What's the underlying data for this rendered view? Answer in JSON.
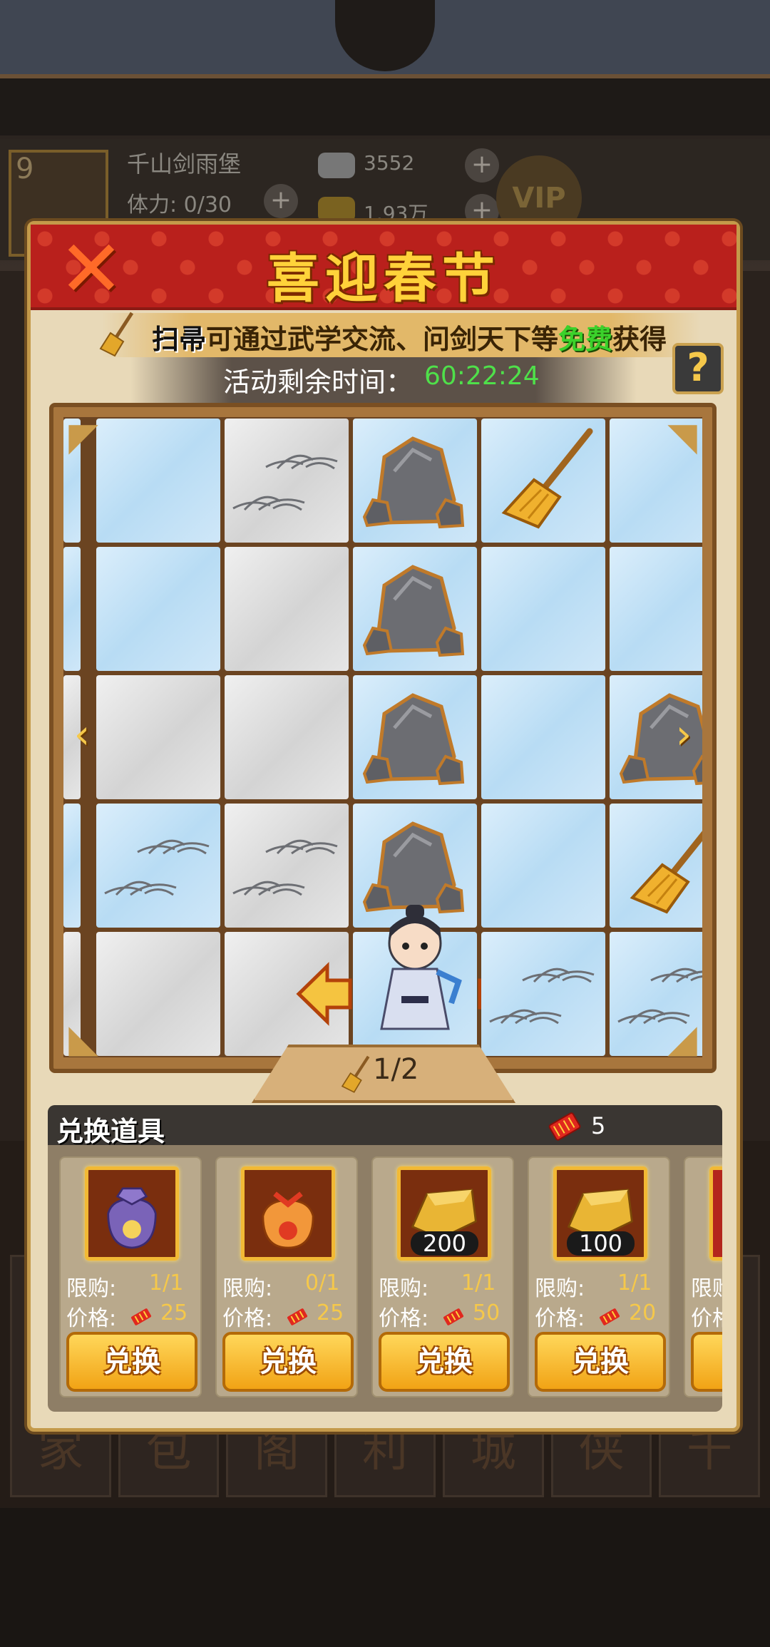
{
  "background": {
    "level": "9",
    "player_name": "千山剑雨堡",
    "stamina": "体力: 0/30",
    "silver": "3552",
    "gold": "1.93万",
    "vip_label": "VIP",
    "bottom_tabs": [
      "家",
      "包",
      "阁",
      "利",
      "城",
      "侠",
      "千"
    ]
  },
  "event": {
    "title": "喜迎春节",
    "close_symbol": "✕",
    "hint": {
      "keyword": "扫帚",
      "text1": "可通过武学交流、问剑天下等",
      "highlight": "免费",
      "text2": "获得"
    },
    "timer_label": "活动剩余时间：",
    "timer_value": "60:22:24",
    "help_symbol": "?",
    "page_indicator": "1/2",
    "board": {
      "rows": [
        [
          "snow",
          "gray-grass",
          "snow-rock",
          "snow-broom",
          "snow"
        ],
        [
          "snow",
          "gray",
          "snow-rock",
          "snow",
          "snow"
        ],
        [
          "gray",
          "gray",
          "snow-rock",
          "snow",
          "snow-rock"
        ],
        [
          "snow-grass",
          "gray-grass",
          "snow-rock",
          "snow",
          "snow-broom"
        ],
        [
          "gray",
          "gray",
          "hero",
          "snow-grass",
          "snow-grass"
        ]
      ]
    }
  },
  "shop": {
    "title": "兑换道具",
    "token_count": "5",
    "limit_label": "限购:",
    "price_label": "价格:",
    "button_label": "兑换",
    "items": [
      {
        "icon": "purple-bag",
        "qty": "",
        "limit": "1/1",
        "price": "25"
      },
      {
        "icon": "orange-bag",
        "qty": "",
        "limit": "0/1",
        "price": "25"
      },
      {
        "icon": "gold-ingot",
        "qty": "200",
        "limit": "1/1",
        "price": "50"
      },
      {
        "icon": "gold-ingot",
        "qty": "100",
        "limit": "1/1",
        "price": "20"
      },
      {
        "icon": "red-scroll",
        "qty": "",
        "limit": "",
        "price": ""
      }
    ]
  },
  "colors": {
    "header_red": "#b9201c",
    "title_gold": "#ffd23a",
    "timer_green": "#4fe04a",
    "free_green": "#3bd12b",
    "button_gold": "#f1a315"
  }
}
